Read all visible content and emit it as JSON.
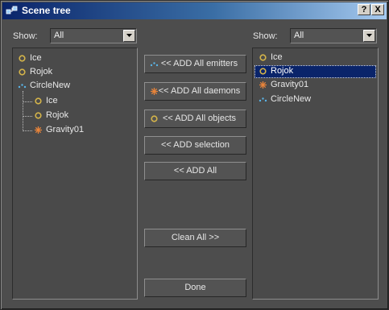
{
  "window": {
    "title": "Scene tree"
  },
  "titlebar_buttons": {
    "help": "?",
    "close": "X"
  },
  "left": {
    "show_label": "Show:",
    "filter_value": "All",
    "items": [
      {
        "label": "Ice",
        "icon": "object-icon"
      },
      {
        "label": "Rojok",
        "icon": "object-icon"
      },
      {
        "label": "CircleNew",
        "icon": "emitter-icon"
      },
      {
        "label": "Ice",
        "icon": "object-icon"
      },
      {
        "label": "Rojok",
        "icon": "object-icon"
      },
      {
        "label": "Gravity01",
        "icon": "daemon-icon"
      }
    ]
  },
  "right": {
    "show_label": "Show:",
    "filter_value": "All",
    "items": [
      {
        "label": "Ice",
        "icon": "object-icon"
      },
      {
        "label": "Rojok",
        "icon": "object-icon",
        "selected": true
      },
      {
        "label": "Gravity01",
        "icon": "daemon-icon"
      },
      {
        "label": "CircleNew",
        "icon": "emitter-icon"
      }
    ]
  },
  "buttons": {
    "add_emitters": "<< ADD All emitters",
    "add_daemons": "<< ADD All daemons",
    "add_objects": "<< ADD All objects",
    "add_selection": "<< ADD selection",
    "add_all": "<< ADD All",
    "clean_all": "Clean All >>",
    "done": "Done"
  },
  "colors": {
    "object": "#d4b44a",
    "emitter": "#5ab4e6",
    "daemon": "#e8843a",
    "selection": "#0a246a"
  }
}
